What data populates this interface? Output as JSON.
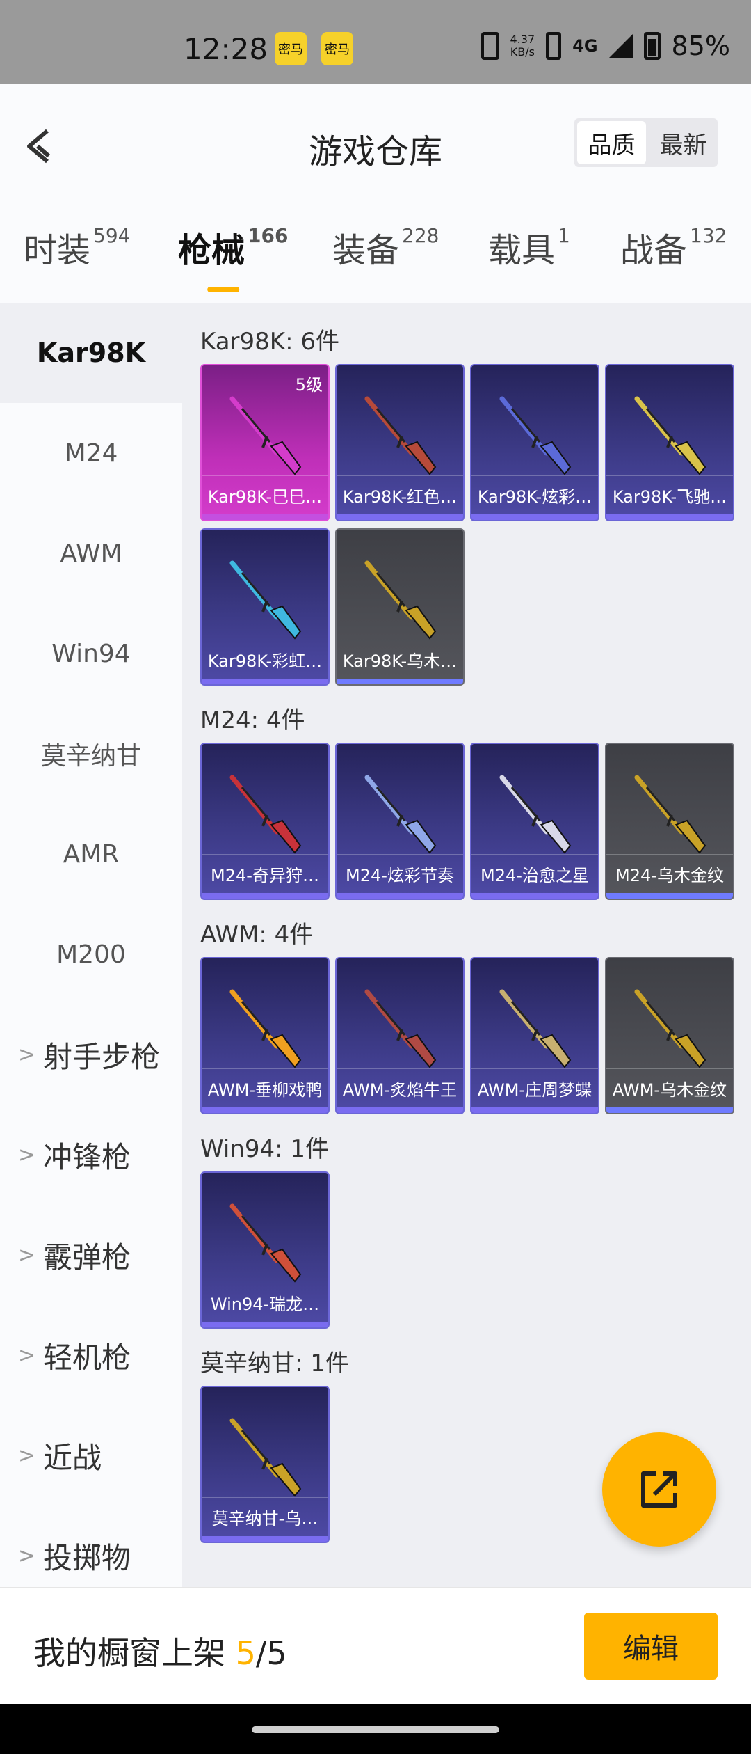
{
  "status_bar": {
    "time": "12:28",
    "app_badges": [
      "密马",
      "密马"
    ],
    "net_speed": "4.37",
    "net_unit": "KB/s",
    "network": "4G",
    "battery": "85%"
  },
  "header": {
    "title": "游戏仓库",
    "sort_options": [
      "品质",
      "最新"
    ],
    "sort_selected": "品质",
    "back_icon": "back-arrow-icon"
  },
  "tabs": [
    {
      "label": "时装",
      "count": "594"
    },
    {
      "label": "枪械",
      "count": "166",
      "active": true
    },
    {
      "label": "装备",
      "count": "228"
    },
    {
      "label": "载具",
      "count": "1"
    },
    {
      "label": "战备",
      "count": "132"
    }
  ],
  "sidebar": {
    "items": [
      "Kar98K",
      "M24",
      "AWM",
      "Win94",
      "莫辛纳甘",
      "AMR",
      "M200"
    ],
    "selected": "Kar98K",
    "categories": [
      "射手步枪",
      "冲锋枪",
      "霰弹枪",
      "轻机枪",
      "近战",
      "投掷物"
    ]
  },
  "sections": [
    {
      "title": "Kar98K: 6件",
      "items": [
        {
          "label": "Kar98K-巳巳…",
          "level": "5级",
          "style": "pink",
          "accent": "#d43ccb"
        },
        {
          "label": "Kar98K-红色…",
          "style": "purple",
          "accent": "#b64a3a"
        },
        {
          "label": "Kar98K-炫彩…",
          "style": "purple",
          "accent": "#5b6ad8"
        },
        {
          "label": "Kar98K-飞驰…",
          "style": "purple",
          "accent": "#d9c24a"
        },
        {
          "label": "Kar98K-彩虹…",
          "style": "purple",
          "accent": "#3fb8e0"
        },
        {
          "label": "Kar98K-乌木…",
          "style": "gray",
          "accent": "#c9a227"
        }
      ]
    },
    {
      "title": "M24: 4件",
      "items": [
        {
          "label": "M24-奇异狩…",
          "style": "purple",
          "accent": "#c8323a"
        },
        {
          "label": "M24-炫彩节奏",
          "style": "purple",
          "accent": "#8fa7e8"
        },
        {
          "label": "M24-治愈之星",
          "style": "purple",
          "accent": "#d8d8e8"
        },
        {
          "label": "M24-乌木金纹",
          "style": "gray",
          "accent": "#c9a227"
        }
      ]
    },
    {
      "title": "AWM: 4件",
      "items": [
        {
          "label": "AWM-垂柳戏鸭",
          "style": "purple",
          "accent": "#f0a020"
        },
        {
          "label": "AWM-炙焰牛王",
          "style": "purple",
          "accent": "#b04a44"
        },
        {
          "label": "AWM-庄周梦蝶",
          "style": "purple",
          "accent": "#c8b070"
        },
        {
          "label": "AWM-乌木金纹",
          "style": "gray",
          "accent": "#c9a227"
        }
      ]
    },
    {
      "title": "Win94: 1件",
      "items": [
        {
          "label": "Win94-瑞龙…",
          "style": "purple",
          "accent": "#d0503a"
        }
      ]
    },
    {
      "title": "莫辛纳甘: 1件",
      "items": [
        {
          "label": "莫辛纳甘-乌…",
          "style": "purple",
          "accent": "#c9a227"
        }
      ]
    }
  ],
  "fab_icon": "share-export-icon",
  "bottom_bar": {
    "showcase_label": "我的橱窗上架",
    "showcase_count": "5",
    "showcase_total": "/5",
    "edit_label": "编辑"
  },
  "colors": {
    "accent": "#ffb300",
    "card_purple": "#3c3a86",
    "card_pink": "#bf2fb8",
    "card_gray": "#55565c"
  }
}
